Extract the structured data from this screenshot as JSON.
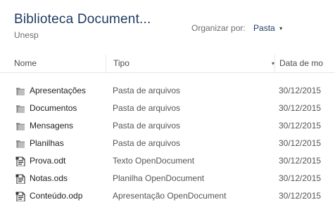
{
  "library": {
    "title": "Biblioteca Document...",
    "subtitle": "Unesp"
  },
  "arrange": {
    "label": "Organizar por:",
    "value": "Pasta",
    "caret": "▾"
  },
  "columns": {
    "name": "Nome",
    "type": "Tipo",
    "type_sort": "▾",
    "date": "Data de mo"
  },
  "files": [
    {
      "name": "Apresentações",
      "type": "Pasta de arquivos",
      "date": "30/12/2015",
      "icon": "folder-icon"
    },
    {
      "name": "Documentos",
      "type": "Pasta de arquivos",
      "date": "30/12/2015",
      "icon": "folder-icon"
    },
    {
      "name": "Mensagens",
      "type": "Pasta de arquivos",
      "date": "30/12/2015",
      "icon": "folder-icon"
    },
    {
      "name": "Planilhas",
      "type": "Pasta de arquivos",
      "date": "30/12/2015",
      "icon": "folder-icon"
    },
    {
      "name": "Prova.odt",
      "type": "Texto OpenDocument",
      "date": "30/12/2015",
      "icon": "document-icon"
    },
    {
      "name": "Notas.ods",
      "type": "Planilha OpenDocument",
      "date": "30/12/2015",
      "icon": "document-icon"
    },
    {
      "name": "Conteúdo.odp",
      "type": "Apresentação OpenDocument",
      "date": "30/12/2015",
      "icon": "document-icon"
    }
  ]
}
